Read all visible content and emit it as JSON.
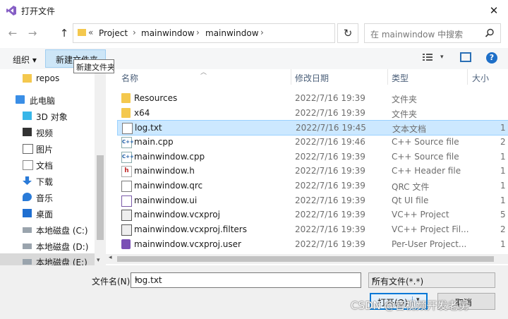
{
  "window": {
    "title": "打开文件",
    "close_glyph": "✕"
  },
  "nav": {
    "back": "←",
    "forward": "→",
    "up": "↑",
    "refresh": "↻"
  },
  "address": {
    "crumbs": [
      "Project",
      "mainwindow",
      "mainwindow"
    ],
    "overflow": "«",
    "sep": "›"
  },
  "search": {
    "placeholder": "在 mainwindow 中搜索",
    "icon": "search-icon"
  },
  "toolbar": {
    "organize": "组织 ▾",
    "new_folder": "新建文件夹",
    "tooltip": "新建文件夹。",
    "help": "?"
  },
  "sidebar": {
    "items": [
      {
        "label": "repos",
        "icon": "folder-icon"
      },
      {
        "label": "此电脑",
        "icon": "computer-icon"
      },
      {
        "label": "3D 对象",
        "icon": "cube-icon"
      },
      {
        "label": "视频",
        "icon": "video-icon"
      },
      {
        "label": "图片",
        "icon": "picture-icon"
      },
      {
        "label": "文档",
        "icon": "document-icon"
      },
      {
        "label": "下载",
        "icon": "download-icon"
      },
      {
        "label": "音乐",
        "icon": "music-icon"
      },
      {
        "label": "桌面",
        "icon": "desktop-icon"
      },
      {
        "label": "本地磁盘 (C:)",
        "icon": "drive-icon"
      },
      {
        "label": "本地磁盘 (D:)",
        "icon": "drive-icon"
      },
      {
        "label": "本地磁盘 (E:)",
        "icon": "drive-icon"
      }
    ]
  },
  "columns": {
    "name": "名称",
    "date": "修改日期",
    "type": "类型",
    "size": "大小"
  },
  "files": [
    {
      "name": "Resources",
      "date": "2022/7/16 19:39",
      "type": "文件夹",
      "size": "",
      "icon": "folder"
    },
    {
      "name": "x64",
      "date": "2022/7/16 19:39",
      "type": "文件夹",
      "size": "",
      "icon": "folder"
    },
    {
      "name": "log.txt",
      "date": "2022/7/16 19:45",
      "type": "文本文档",
      "size": "1",
      "icon": "doc"
    },
    {
      "name": "main.cpp",
      "date": "2022/7/16 19:46",
      "type": "C++ Source file",
      "size": "2",
      "icon": "cpp"
    },
    {
      "name": "mainwindow.cpp",
      "date": "2022/7/16 19:39",
      "type": "C++ Source file",
      "size": "1",
      "icon": "cpp"
    },
    {
      "name": "mainwindow.h",
      "date": "2022/7/16 19:39",
      "type": "C++ Header file",
      "size": "1",
      "icon": "hdr"
    },
    {
      "name": "mainwindow.qrc",
      "date": "2022/7/16 19:39",
      "type": "QRC 文件",
      "size": "1",
      "icon": "doc"
    },
    {
      "name": "mainwindow.ui",
      "date": "2022/7/16 19:39",
      "type": "Qt UI file",
      "size": "1",
      "icon": "proj"
    },
    {
      "name": "mainwindow.vcxproj",
      "date": "2022/7/16 19:39",
      "type": "VC++ Project",
      "size": "5",
      "icon": "projf"
    },
    {
      "name": "mainwindow.vcxproj.filters",
      "date": "2022/7/16 19:39",
      "type": "VC++ Project Fil...",
      "size": "2",
      "icon": "projf"
    },
    {
      "name": "mainwindow.vcxproj.user",
      "date": "2022/7/16 19:39",
      "type": "Per-User Project...",
      "size": "1",
      "icon": "vs"
    }
  ],
  "footer": {
    "filename_label": "文件名(N):",
    "filename_value": "log.txt",
    "filter_value": "所有文件(*.*)",
    "open_label": "打开(O)",
    "cancel_label": "取消",
    "dropdown": "▾"
  },
  "watermark": "CSDN @音视频开发老舅",
  "colors": {
    "accent": "#0078d7",
    "selection": "#cce8ff",
    "folder": "#f4c84e"
  }
}
